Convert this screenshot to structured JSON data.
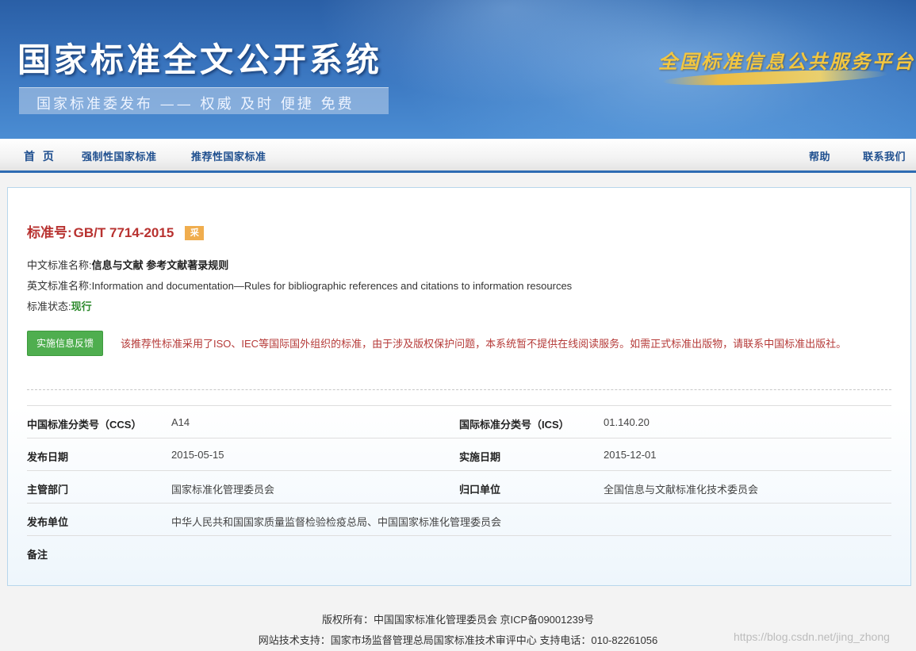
{
  "header": {
    "site_title": "国家标准全文公开系统",
    "slogan": "国家标准委发布 —— 权威 及时 便捷 免费",
    "platform_name": "全国标准信息公共服务平台"
  },
  "nav": {
    "home": "首 页",
    "mandatory": "强制性国家标准",
    "recommended": "推荐性国家标准",
    "help": "帮助",
    "contact": "联系我们"
  },
  "standard": {
    "number_label": "标准号:",
    "number": "GB/T 7714-2015",
    "adopt_badge": "采",
    "cn_name_label": "中文标准名称:",
    "cn_name": "信息与文献 参考文献著录规则",
    "en_name_label": "英文标准名称:",
    "en_name": "Information and documentation—Rules for bibliographic references and citations to information resources",
    "status_label": "标准状态:",
    "status": "现行"
  },
  "feedback_button": "实施信息反馈",
  "notice": "该推荐性标准采用了ISO、IEC等国际国外组织的标准，由于涉及版权保护问题，本系统暂不提供在线阅读服务。如需正式标准出版物，请联系中国标准出版社。",
  "meta": {
    "ccs_label": "中国标准分类号（CCS）",
    "ccs": "A14",
    "ics_label": "国际标准分类号（ICS）",
    "ics": "01.140.20",
    "publish_date_label": "发布日期",
    "publish_date": "2015-05-15",
    "implement_date_label": "实施日期",
    "implement_date": "2015-12-01",
    "authority_label": "主管部门",
    "authority": "国家标准化管理委员会",
    "owner_label": "归口单位",
    "owner": "全国信息与文献标准化技术委员会",
    "publisher_label": "发布单位",
    "publisher": "中华人民共和国国家质量监督检验检疫总局、中国国家标准化管理委员会",
    "remark_label": "备注",
    "remark": ""
  },
  "footer": {
    "copyright": "版权所有：中国国家标准化管理委员会 京ICP备09001239号",
    "support": "网站技术支持：国家市场监督管理总局国家标准技术审评中心 支持电话：010-82261056"
  },
  "watermark": "https://blog.csdn.net/jing_zhong",
  "colors": {
    "header_blue": "#3873bd",
    "nav_text": "#1f4f8f",
    "accent_red": "#b83230",
    "status_green": "#2e8b2e",
    "button_green": "#4fae4f",
    "badge_orange": "#f0ad4e"
  }
}
